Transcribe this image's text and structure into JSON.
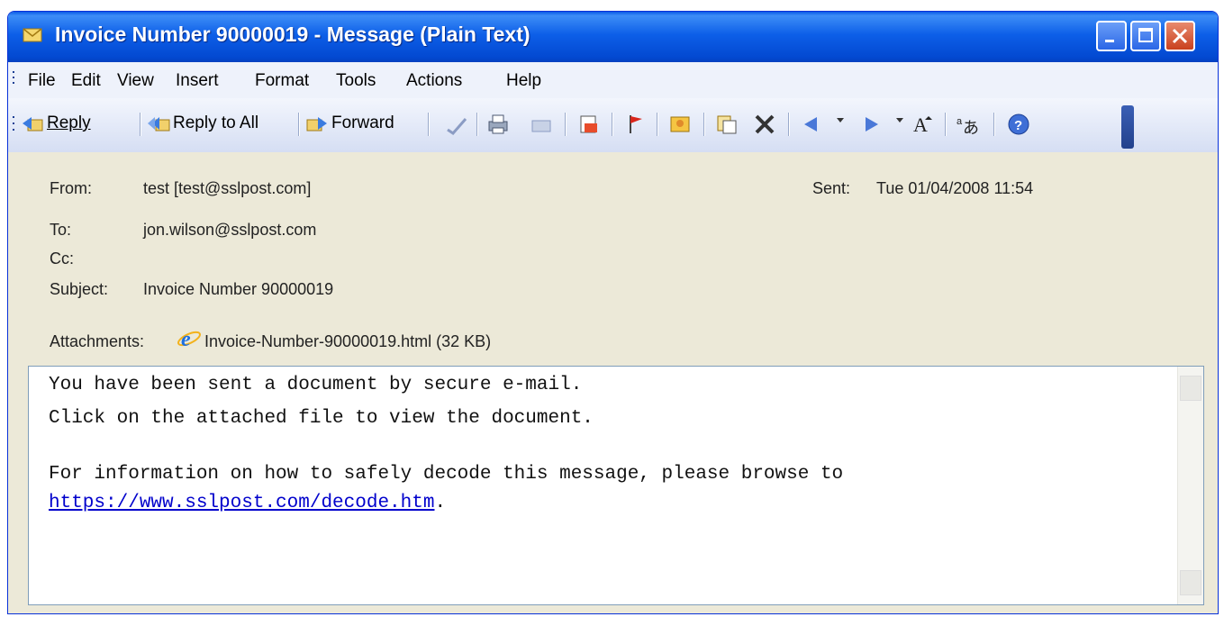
{
  "window": {
    "title": "Invoice Number 90000019 - Message (Plain Text)"
  },
  "menu": [
    "File",
    "Edit",
    "View",
    "Insert",
    "Format",
    "Tools",
    "Actions",
    "Help"
  ],
  "toolbar": {
    "reply": "Reply",
    "reply_all": "Reply to All",
    "forward": "Forward"
  },
  "header": {
    "from_label": "From:",
    "from_value": "test [test@sslpost.com]",
    "sent_label": "Sent:",
    "sent_value": "Tue 01/04/2008 11:54",
    "to_label": "To:",
    "to_value": "jon.wilson@sslpost.com",
    "cc_label": "Cc:",
    "cc_value": "",
    "subject_label": "Subject:",
    "subject_value": "Invoice Number 90000019",
    "attachments_label": "Attachments:",
    "attachment_name": "Invoice-Number-90000019.html (32 KB)"
  },
  "body": {
    "line1": "You have been sent a document by secure e-mail.",
    "line2": "Click on the attached file to view the document.",
    "line3": "For information on how to safely decode this message, please browse to",
    "link": "https://www.sslpost.com/decode.htm",
    "link_suffix": "."
  }
}
